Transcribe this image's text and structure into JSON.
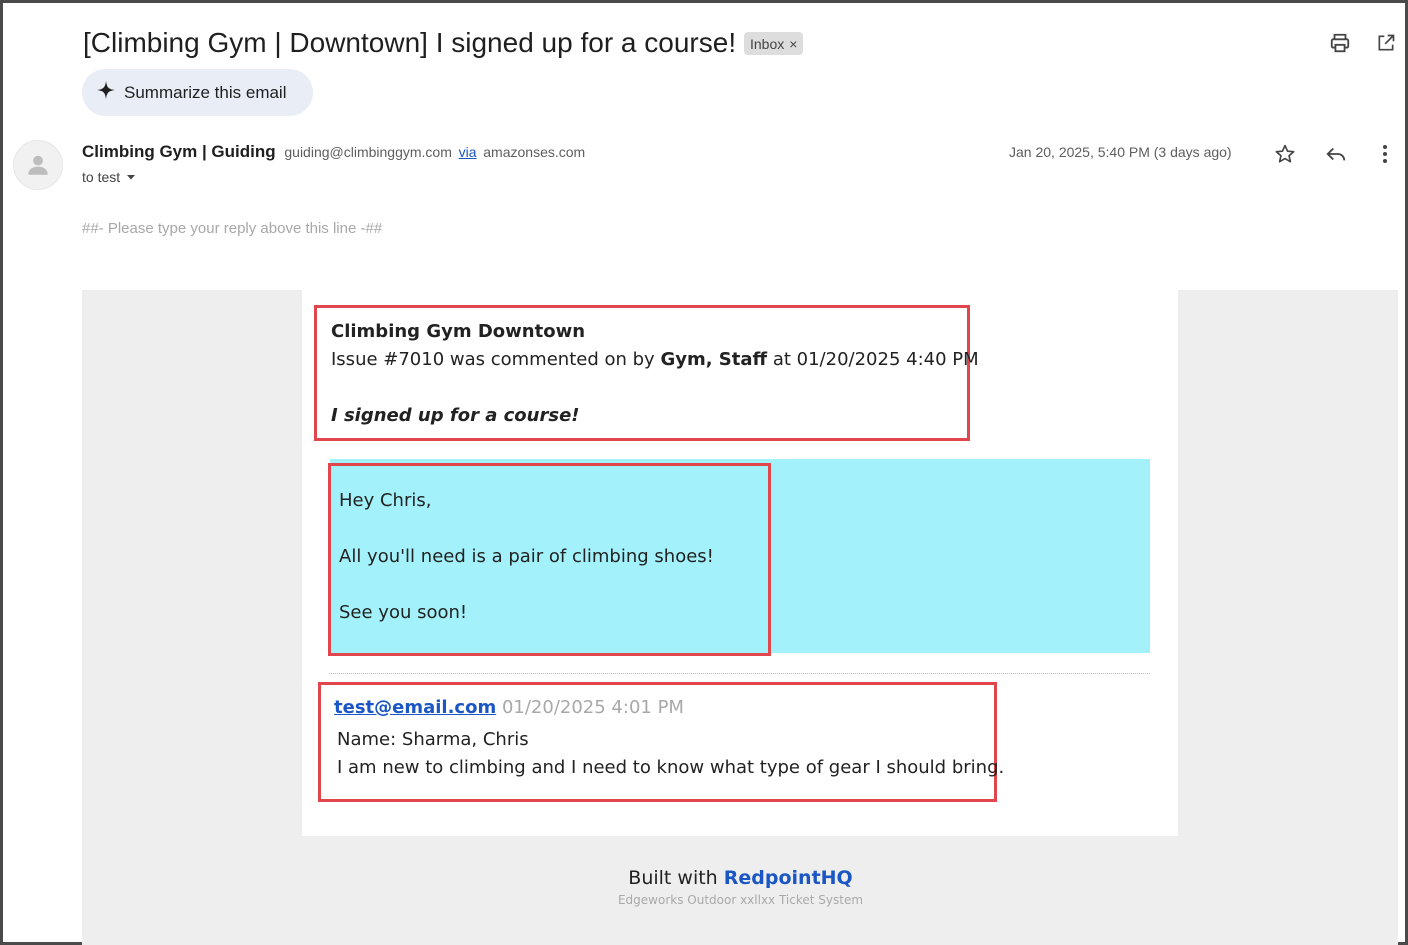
{
  "email": {
    "subject": "[Climbing Gym | Downtown] I signed up for a course!",
    "label_chip": "Inbox",
    "label_chip_remove": "×",
    "summarize_label": "Summarize this email",
    "sender_name": "Climbing Gym | Guiding",
    "sender_email": "guiding@climbinggym.com",
    "via_label": "via",
    "via_domain": "amazonses.com",
    "to_line": "to test",
    "date": "Jan 20, 2025, 5:40 PM (3 days ago)",
    "reply_marker": "##- Please type your reply above this line -##"
  },
  "ticket": {
    "org": "Climbing Gym Downtown",
    "issue_prefix": "Issue #7010 was commented on by",
    "commenter": "Gym, Staff",
    "issue_suffix": "at 01/20/2025 4:40 PM",
    "title": "I signed up for a course!"
  },
  "reply": {
    "greeting": "Hey Chris,",
    "body": "All you'll need is a pair of climbing shoes!",
    "closing": "See you soon!"
  },
  "original": {
    "author_email": "test@email.com",
    "timestamp": "01/20/2025 4:01 PM",
    "name_line": "Name: Sharma, Chris",
    "message": "I am new to climbing and I need to know what type of gear I should bring."
  },
  "footer": {
    "built_with": "Built with",
    "brand": "RedpointHQ",
    "system": "Edgeworks Outdoor xxllxx Ticket System"
  },
  "colors": {
    "highlight_box": "#e0464c",
    "reply_background": "#a3f1fa",
    "link": "#1a56c4"
  },
  "icons": [
    "print-icon",
    "open-in-new-icon",
    "sparkle-icon",
    "avatar-icon",
    "dropdown-icon",
    "star-icon",
    "reply-icon",
    "more-vert-icon"
  ]
}
